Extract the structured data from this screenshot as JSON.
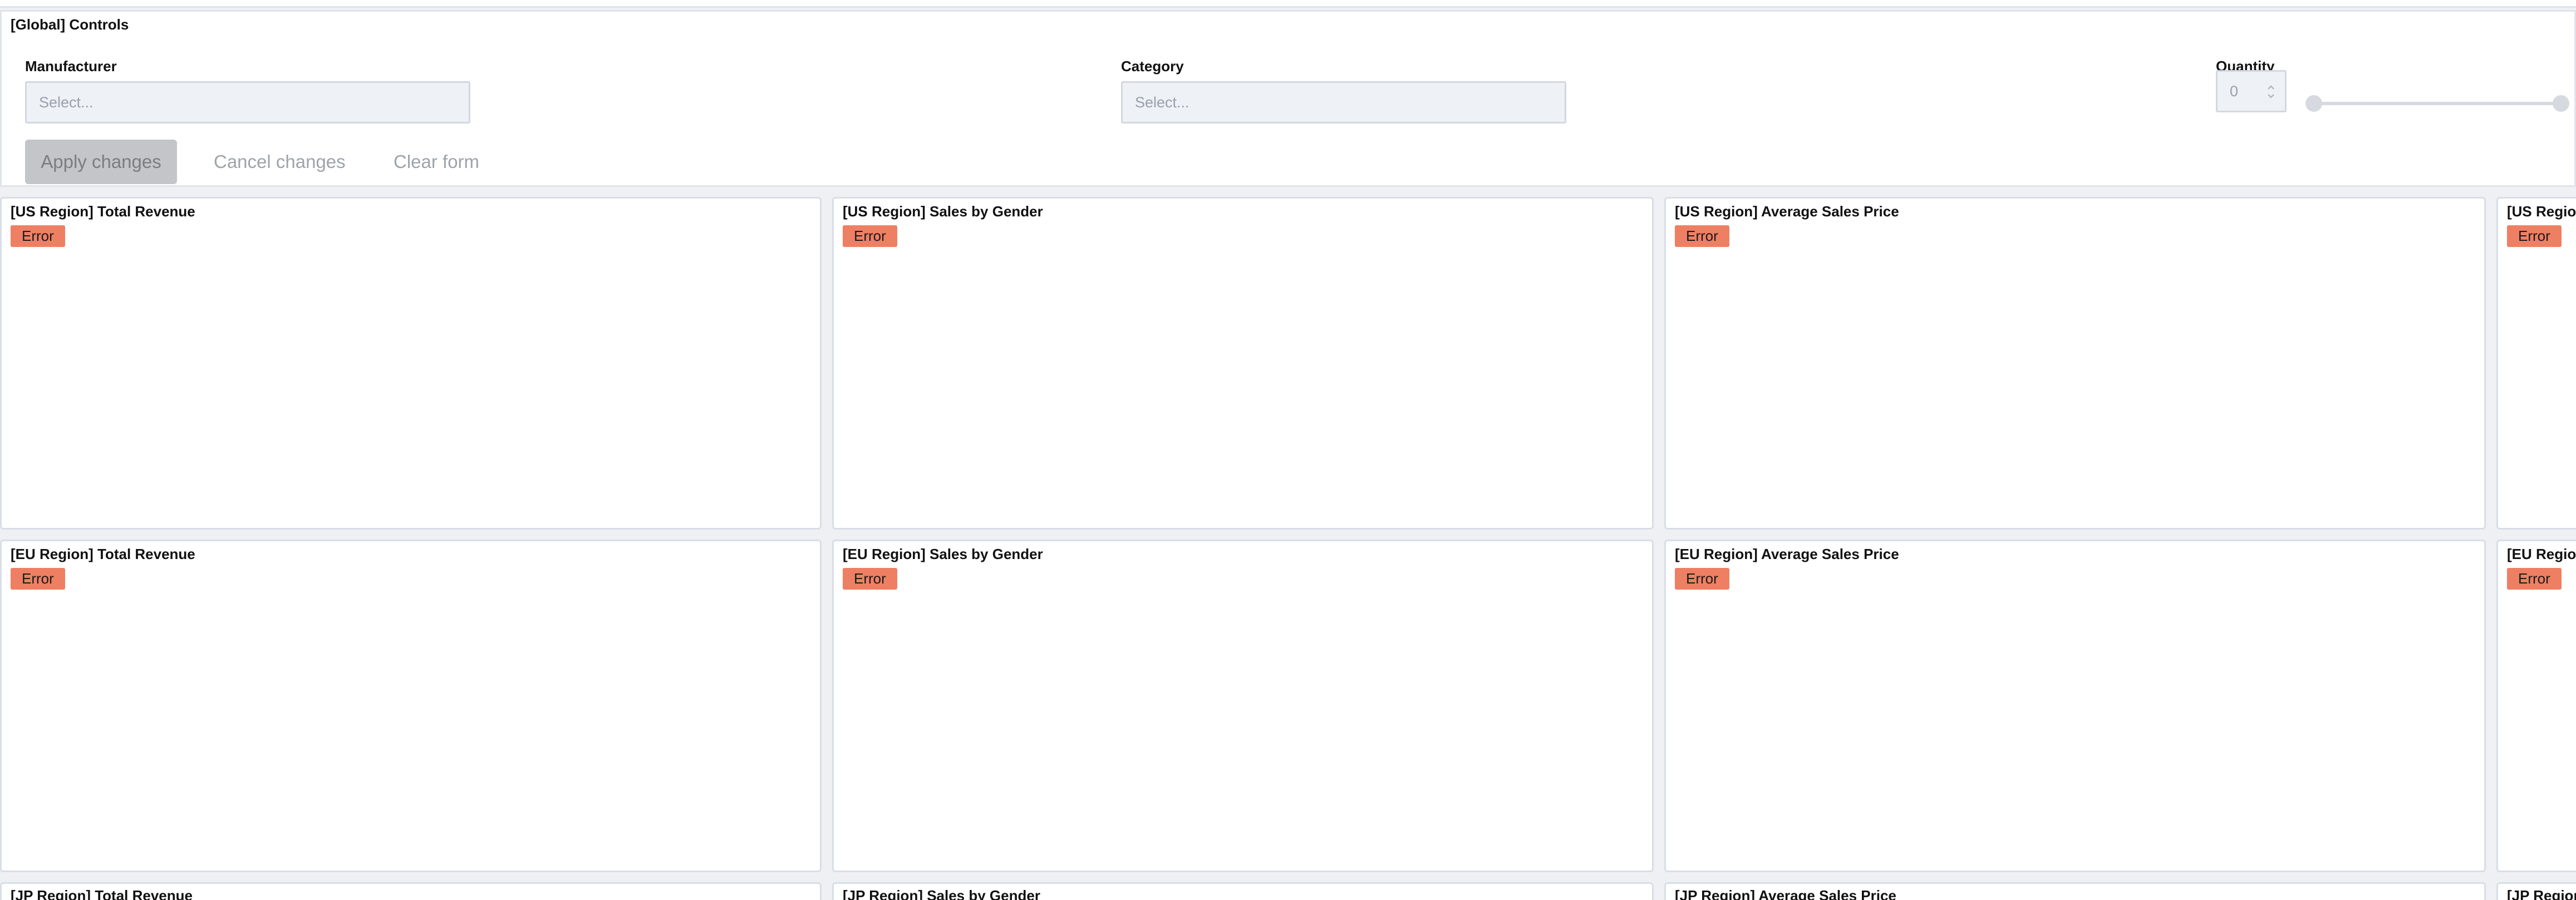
{
  "controls": {
    "title": "[Global] Controls",
    "manufacturer": {
      "label": "Manufacturer",
      "placeholder": "Select..."
    },
    "category": {
      "label": "Category",
      "placeholder": "Select..."
    },
    "quantity": {
      "label": "Quantity",
      "value": "0"
    },
    "buttons": {
      "apply": "Apply changes",
      "cancel": "Cancel changes",
      "clear": "Clear form"
    }
  },
  "cards": [
    {
      "title": "[US Region] Total Revenue",
      "status": "Error"
    },
    {
      "title": "[US Region] Sales by Gender",
      "status": "Error"
    },
    {
      "title": "[US Region] Average Sales Price",
      "status": "Error"
    },
    {
      "title": "[US Region]",
      "status": "Error"
    },
    {
      "title": "[EU Region] Total Revenue",
      "status": "Error"
    },
    {
      "title": "[EU Region] Sales by Gender",
      "status": "Error"
    },
    {
      "title": "[EU Region] Average Sales Price",
      "status": "Error"
    },
    {
      "title": "[EU Region]",
      "status": "Error"
    },
    {
      "title": "[JP Region] Total Revenue",
      "status": ""
    },
    {
      "title": "[JP Region] Sales by Gender",
      "status": ""
    },
    {
      "title": "[JP Region] Average Sales Price",
      "status": ""
    },
    {
      "title": "[JP Region]",
      "status": ""
    }
  ],
  "colors": {
    "error_badge": "#ef7f63",
    "background": "#eef0f4",
    "panel": "#ffffff"
  }
}
